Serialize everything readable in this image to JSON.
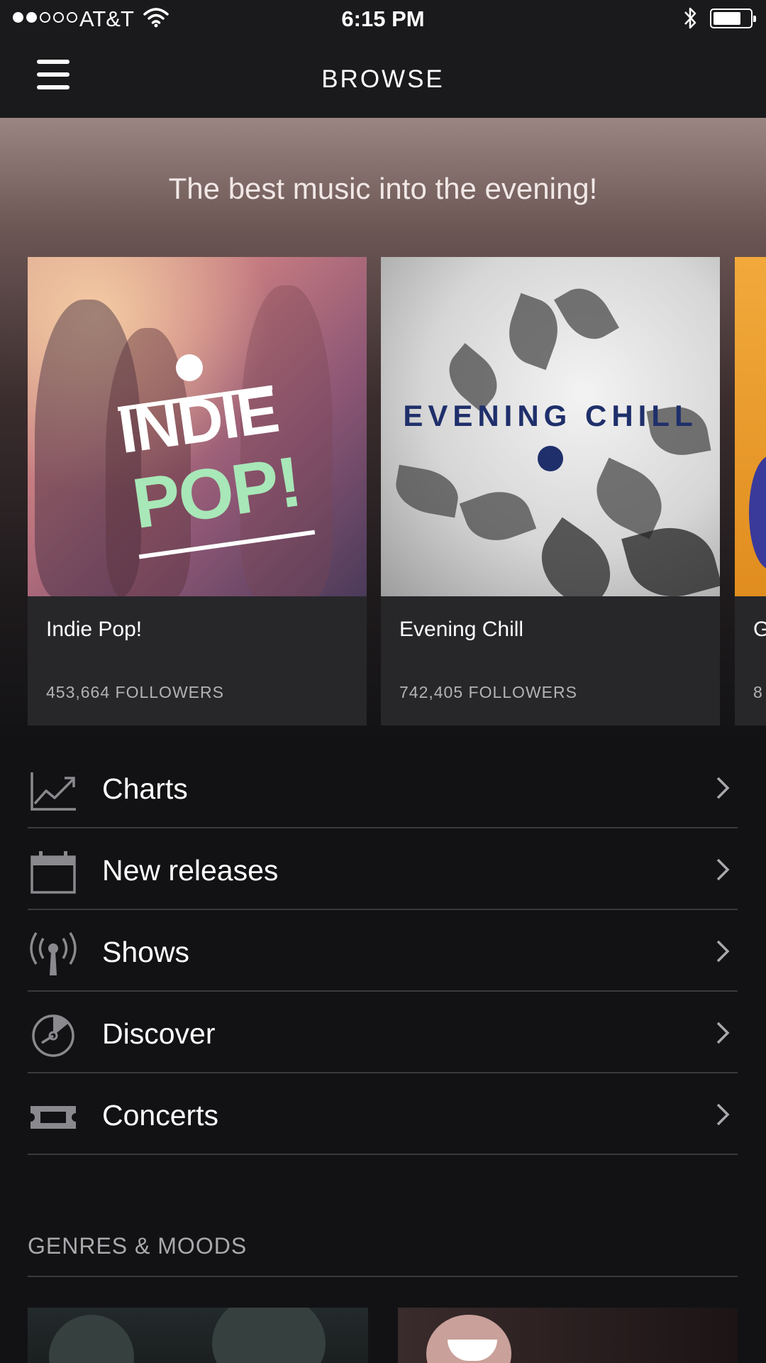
{
  "status_bar": {
    "carrier": "AT&T",
    "time": "6:15 PM",
    "signal_bars_filled": 2,
    "signal_bars_total": 5,
    "battery_level": 0.7
  },
  "nav": {
    "title": "BROWSE",
    "menu_icon": "hamburger-icon"
  },
  "hero": {
    "tagline": "The best music into the evening!",
    "playlists": [
      {
        "name": "Indie Pop!",
        "followers": "453,664 FOLLOWERS",
        "art_text_1": "INDIE",
        "art_text_2": "POP!"
      },
      {
        "name": "Evening Chill",
        "followers": "742,405 FOLLOWERS",
        "art_text_1": "EVENING CHILL"
      },
      {
        "name": "G",
        "followers": "8"
      }
    ]
  },
  "menu": {
    "items": [
      {
        "label": "Charts",
        "icon": "chart-icon"
      },
      {
        "label": "New releases",
        "icon": "calendar-icon"
      },
      {
        "label": "Shows",
        "icon": "podcast-icon"
      },
      {
        "label": "Discover",
        "icon": "discover-icon"
      },
      {
        "label": "Concerts",
        "icon": "ticket-icon"
      }
    ]
  },
  "genres": {
    "title": "GENRES & MOODS"
  },
  "colors": {
    "background": "#121214",
    "card": "#27272a",
    "divider": "#3a3a3d",
    "indie_pop_green": "#a8e7b8",
    "evening_chill_navy": "#1f2f6b"
  }
}
